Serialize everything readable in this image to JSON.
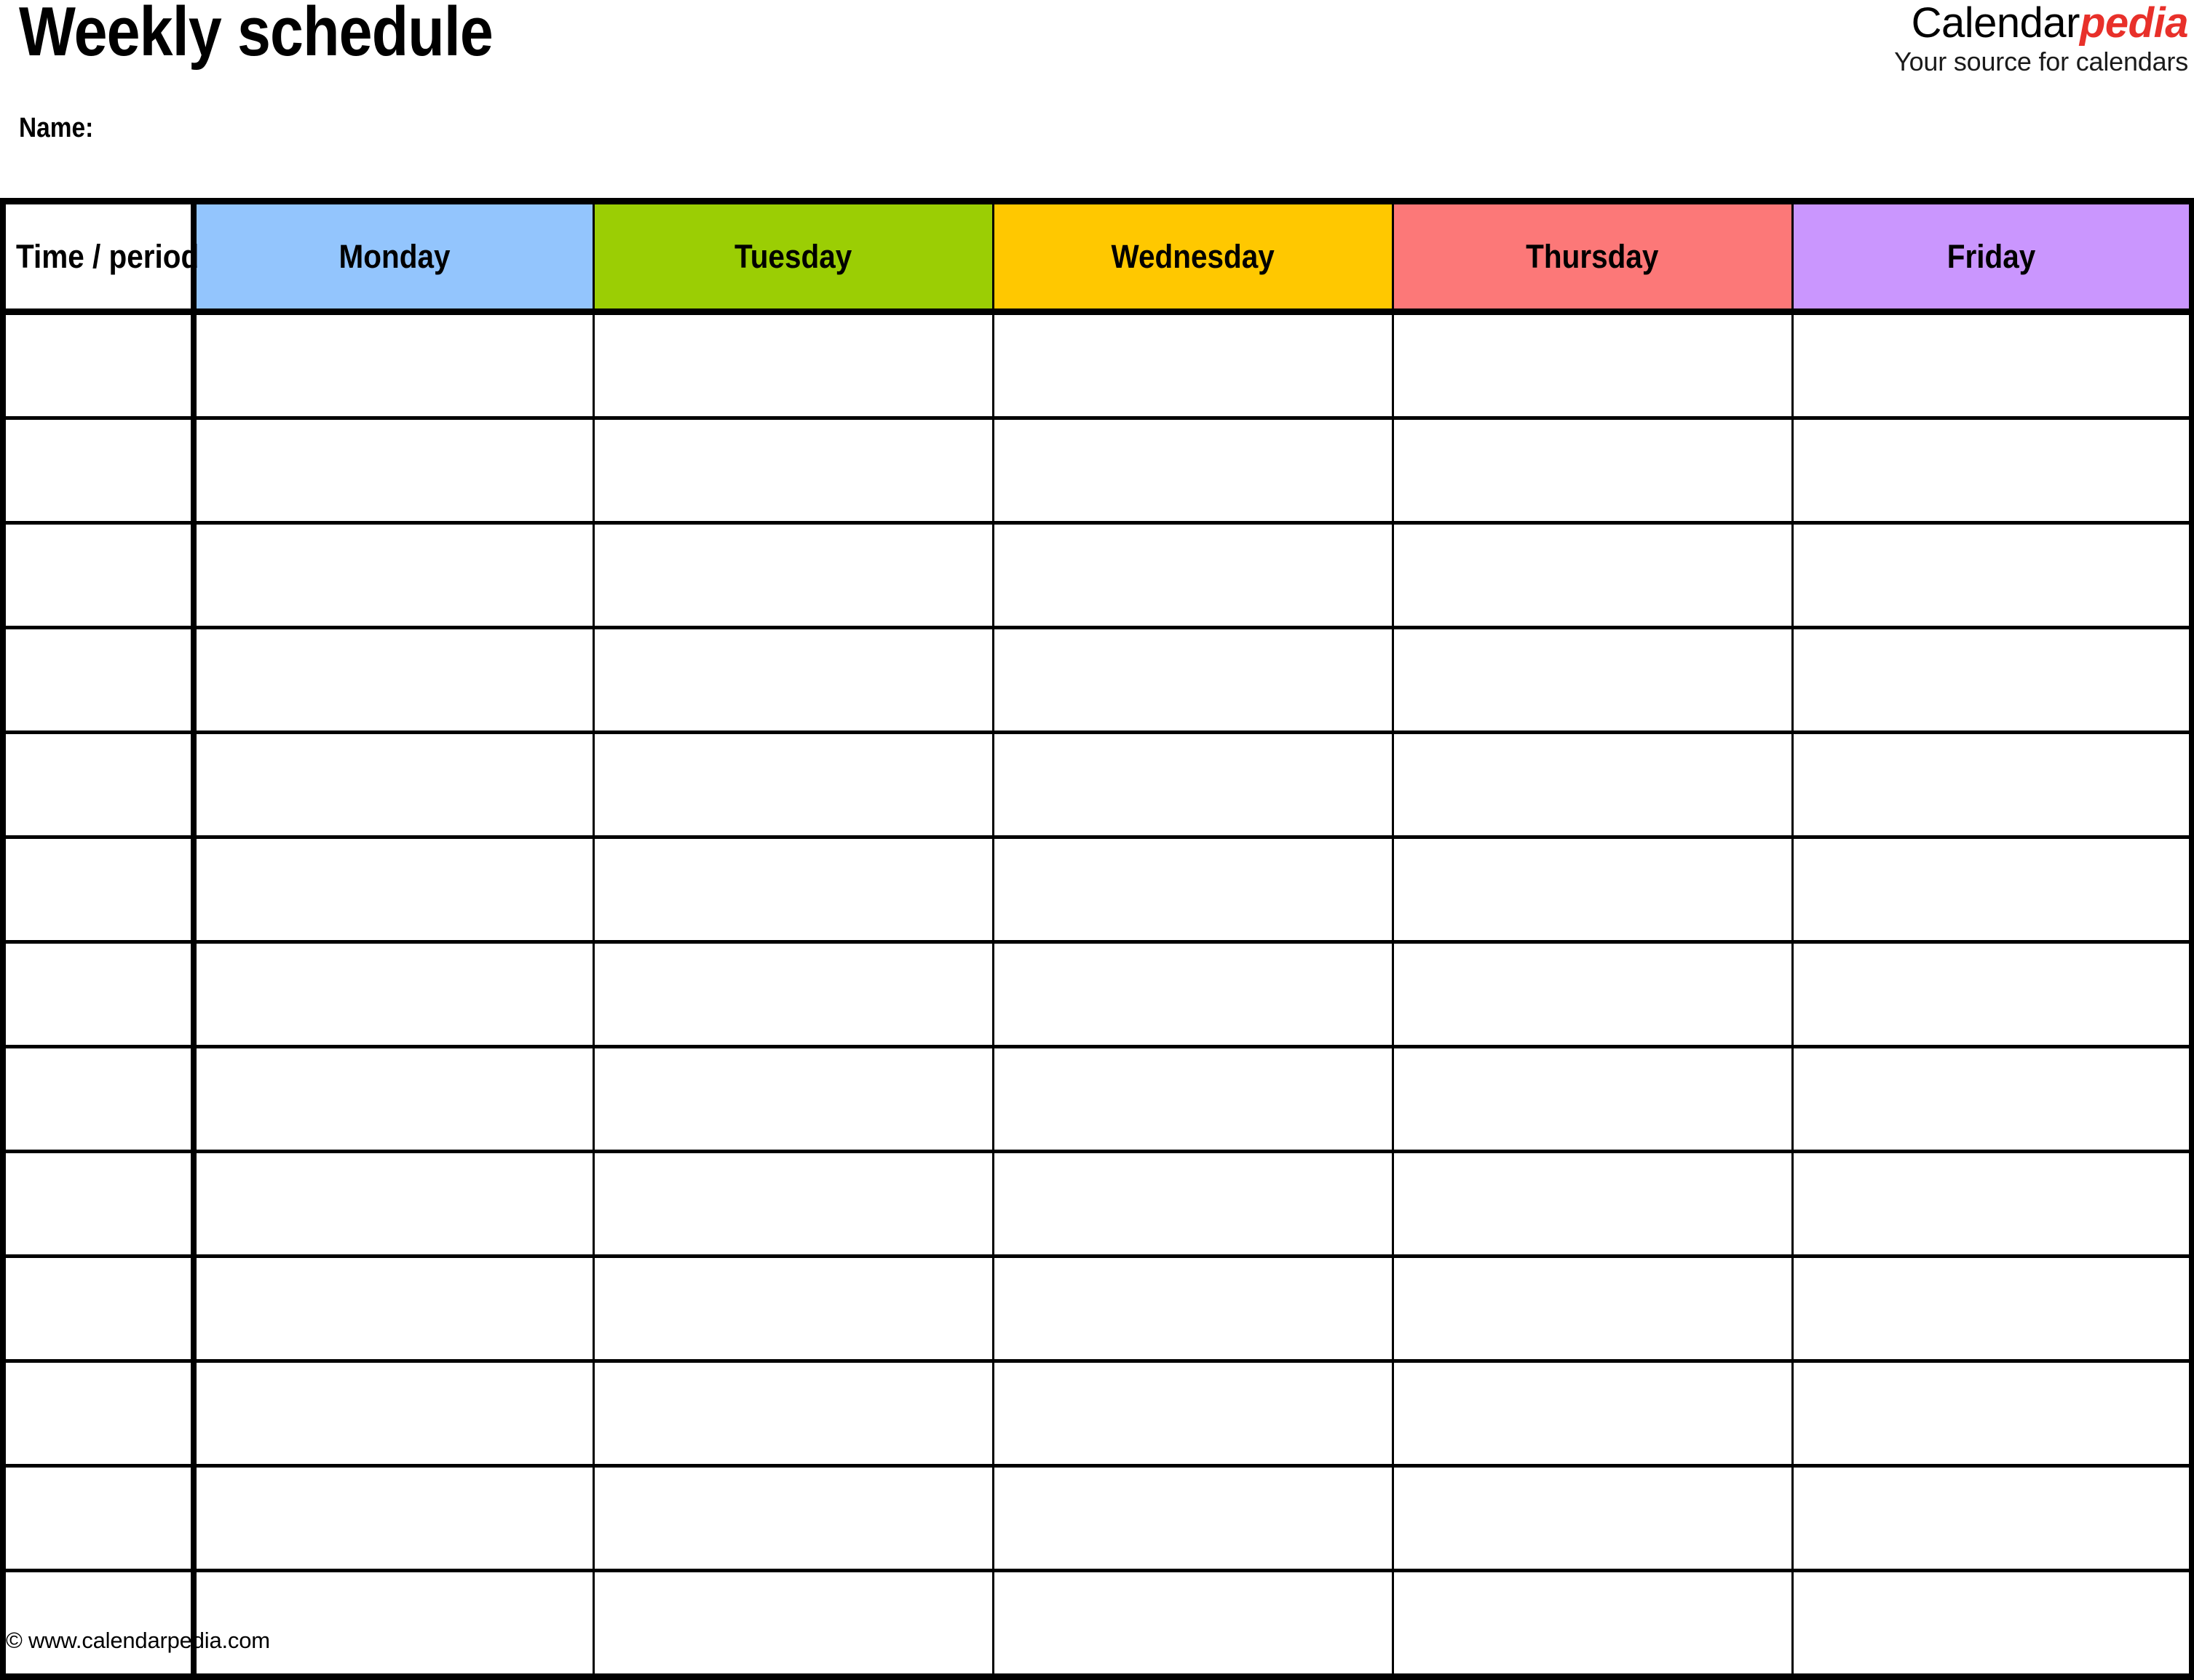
{
  "document": {
    "title": "Weekly schedule",
    "name_label": "Name:"
  },
  "brand": {
    "word_black": "Calendar",
    "word_red": "pedia",
    "tagline": "Your source for calendars",
    "accent_color": "#E8302A"
  },
  "table": {
    "columns": [
      {
        "key": "time",
        "label": "Time / period",
        "header_color": "#FFFFFF"
      },
      {
        "key": "monday",
        "label": "Monday",
        "header_color": "#93C5FD"
      },
      {
        "key": "tuesday",
        "label": "Tuesday",
        "header_color": "#9BCE04"
      },
      {
        "key": "wednesday",
        "label": "Wednesday",
        "header_color": "#FFC800"
      },
      {
        "key": "thursday",
        "label": "Thursday",
        "header_color": "#FC7878"
      },
      {
        "key": "friday",
        "label": "Friday",
        "header_color": "#CA96FE"
      }
    ],
    "row_count": 13,
    "rows": [
      {
        "time": "",
        "monday": "",
        "tuesday": "",
        "wednesday": "",
        "thursday": "",
        "friday": ""
      },
      {
        "time": "",
        "monday": "",
        "tuesday": "",
        "wednesday": "",
        "thursday": "",
        "friday": ""
      },
      {
        "time": "",
        "monday": "",
        "tuesday": "",
        "wednesday": "",
        "thursday": "",
        "friday": ""
      },
      {
        "time": "",
        "monday": "",
        "tuesday": "",
        "wednesday": "",
        "thursday": "",
        "friday": ""
      },
      {
        "time": "",
        "monday": "",
        "tuesday": "",
        "wednesday": "",
        "thursday": "",
        "friday": ""
      },
      {
        "time": "",
        "monday": "",
        "tuesday": "",
        "wednesday": "",
        "thursday": "",
        "friday": ""
      },
      {
        "time": "",
        "monday": "",
        "tuesday": "",
        "wednesday": "",
        "thursday": "",
        "friday": ""
      },
      {
        "time": "",
        "monday": "",
        "tuesday": "",
        "wednesday": "",
        "thursday": "",
        "friday": ""
      },
      {
        "time": "",
        "monday": "",
        "tuesday": "",
        "wednesday": "",
        "thursday": "",
        "friday": ""
      },
      {
        "time": "",
        "monday": "",
        "tuesday": "",
        "wednesday": "",
        "thursday": "",
        "friday": ""
      },
      {
        "time": "",
        "monday": "",
        "tuesday": "",
        "wednesday": "",
        "thursday": "",
        "friday": ""
      },
      {
        "time": "",
        "monday": "",
        "tuesday": "",
        "wednesday": "",
        "thursday": "",
        "friday": ""
      },
      {
        "time": "",
        "monday": "",
        "tuesday": "",
        "wednesday": "",
        "thursday": "",
        "friday": ""
      }
    ]
  },
  "footer": {
    "copyright": "© www.calendarpedia.com"
  }
}
